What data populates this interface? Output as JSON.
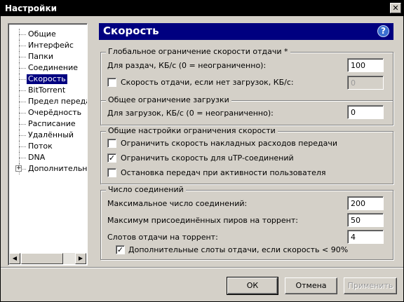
{
  "window": {
    "title": "Настройки",
    "close_symbol": "✕"
  },
  "sidebar": {
    "items": [
      {
        "label": "Общие"
      },
      {
        "label": "Интерфейс"
      },
      {
        "label": "Папки"
      },
      {
        "label": "Соединение"
      },
      {
        "label": "Скорость",
        "selected": true
      },
      {
        "label": "BitTorrent"
      },
      {
        "label": "Предел передачи"
      },
      {
        "label": "Очерёдность"
      },
      {
        "label": "Расписание"
      },
      {
        "label": "Удалённый"
      },
      {
        "label": "Поток"
      },
      {
        "label": "DNA"
      },
      {
        "label": "Дополнительно",
        "expandable": true,
        "expander": "+"
      }
    ],
    "scroll_left": "◀",
    "scroll_right": "▶"
  },
  "page": {
    "title": "Скорость",
    "help_symbol": "?"
  },
  "global_upload": {
    "legend": "Глобальное ограничение скорости отдачи *",
    "seeding_label": "Для раздач, КБ/с (0 = неограниченно):",
    "seeding_value": "100",
    "no_download_label": "Скорость отдачи, если нет загрузок, КБ/с:",
    "no_download_checked": false,
    "no_download_value": "0"
  },
  "global_download": {
    "legend": "Общее ограничение загрузки",
    "download_label": "Для загрузок, КБ/с (0 = неограниченно):",
    "download_value": "0"
  },
  "rate_settings": {
    "legend": "Общие настройки ограничения скорости",
    "opt1_label": "Ограничить скорость накладных расходов передачи",
    "opt1_checked": false,
    "opt2_label": "Ограничить скорость для uTP-соединений",
    "opt2_checked": true,
    "opt3_label": "Остановка передач при активности пользователя",
    "opt3_checked": false
  },
  "connections": {
    "legend": "Число соединений",
    "max_conn_label": "Максимальное число соединений:",
    "max_conn_value": "200",
    "max_peers_label": "Максимум присоединённых пиров на торрент:",
    "max_peers_value": "50",
    "slots_label": "Слотов отдачи на торрент:",
    "slots_value": "4",
    "extra_slots_label": "Дополнительные слоты отдачи, если скорость < 90%",
    "extra_slots_checked": true
  },
  "buttons": {
    "ok": "ОК",
    "cancel": "Отмена",
    "apply": "Применить"
  },
  "check_mark": "✓"
}
